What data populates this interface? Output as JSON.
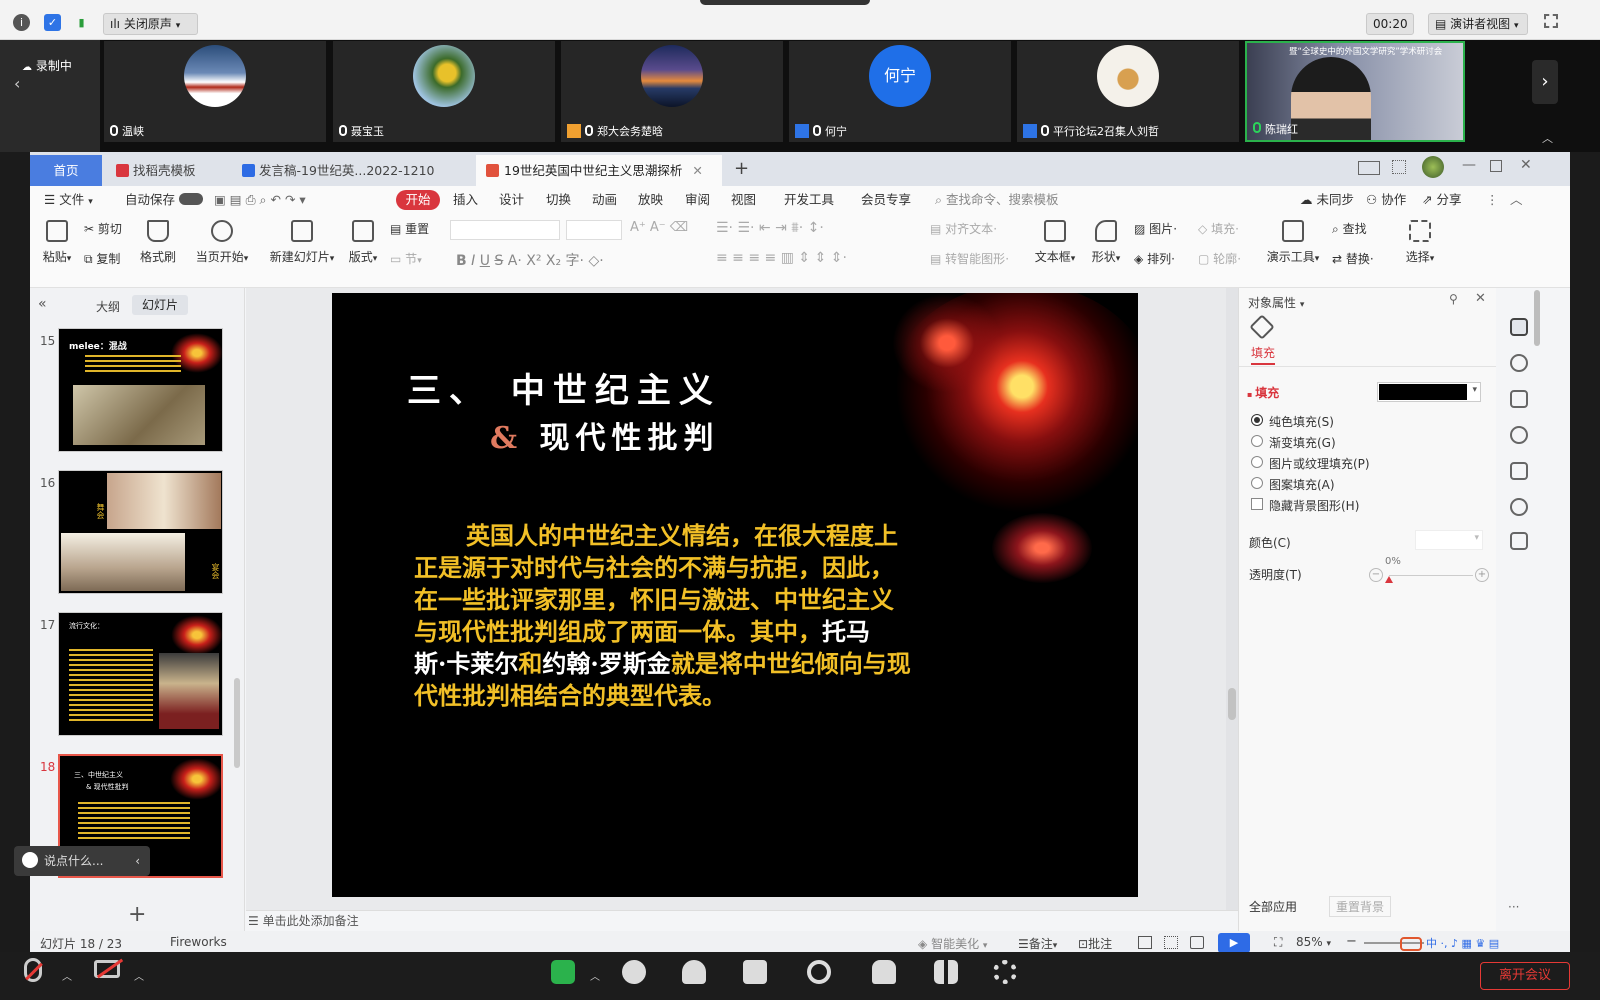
{
  "topbar": {
    "mute_label": "关闭原声",
    "timer": "00:20",
    "view_label": "演讲者视图"
  },
  "participants": {
    "recording": "录制中",
    "tiles": [
      {
        "name": "温峡"
      },
      {
        "name": "聂宝玉"
      },
      {
        "name": "郑大会务楚晗"
      },
      {
        "name": "何宁",
        "avatar_text": "何宁"
      },
      {
        "name": "平行论坛2召集人刘哲"
      },
      {
        "name": "陈瑞红",
        "shared_title": "暨“全球史中的外国文学研究”学术研讨会"
      }
    ]
  },
  "wps": {
    "tabs": {
      "home": "首页",
      "template": "找稻壳模板",
      "doc": "发言稿-19世纪英...2022-1210",
      "ppt": "19世纪英国中世纪主义思潮探析"
    },
    "menu": {
      "file": "文件",
      "autosave": "自动保存",
      "start": "开始",
      "insert": "插入",
      "design": "设计",
      "switch": "切换",
      "animation": "动画",
      "play": "放映",
      "review": "审阅",
      "view": "视图",
      "dev": "开发工具",
      "member": "会员专享",
      "search": "查找命令、搜索模板",
      "unsynced": "未同步",
      "collab": "协作",
      "share": "分享"
    },
    "ribbon": {
      "paste": "粘贴",
      "cut": "剪切",
      "copy": "复制",
      "format_painter": "格式刷",
      "play_from_current": "当页开始",
      "new_slide": "新建幻灯片",
      "layout": "版式",
      "reset": "重置",
      "section": "节",
      "align_text": "对齐文本",
      "smart_shape": "转智能图形",
      "textbox": "文本框",
      "shape": "形状",
      "picture": "图片",
      "arrange": "排列",
      "fill": "填充",
      "outline": "轮廓",
      "present_tool": "演示工具",
      "find": "查找",
      "replace": "替换",
      "select": "选择"
    },
    "left_panel": {
      "outline_tab": "大纲",
      "slides_tab": "幻灯片",
      "slide_numbers": [
        "15",
        "16",
        "17",
        "18"
      ],
      "thumb15_title": "melee：混战",
      "thumb16_left": "舞会",
      "thumb16_right": "宴会",
      "thumb17_title": "流行文化：",
      "thumb18_title": "三、中世纪主义",
      "thumb18_sub": "& 现代性批判",
      "chat_placeholder": "说点什么..."
    },
    "slide": {
      "title_line1": "三、 中世纪主义",
      "title_amp": "&",
      "title_line2": "现代性批判",
      "body_line1": "英国人的中世纪主义情结，在很大程度上",
      "body_line2": "正是源于对时代与社会的不满与抗拒，因此，",
      "body_line3": "在一些批评家那里，怀旧与激进、中世纪主义",
      "body_line4a": "与现代性批判组成了两面一体。其中，",
      "body_line4b": "托马",
      "body_line5a": "斯·卡莱尔",
      "body_line5b": "和",
      "body_line5c": "约翰·罗斯金",
      "body_line5d": "就是将中世纪倾向与现",
      "body_line6": "代性批判相结合的典型代表。"
    },
    "notes_placeholder": "单击此处添加备注",
    "properties": {
      "title": "对象属性",
      "fill_tab": "填充",
      "fill_section": "填充",
      "fill_color": "#000000",
      "options": [
        "纯色填充(S)",
        "渐变填充(G)",
        "图片或纹理填充(P)",
        "图案填充(A)"
      ],
      "hide_bg": "隐藏背景图形(H)",
      "color_label": "颜色(C)",
      "transparency_label": "透明度(T)",
      "transparency_value": "0%",
      "apply_all": "全部应用",
      "reset_bg": "重置背景"
    },
    "status": {
      "slide_counter": "幻灯片 18 / 23",
      "theme": "Fireworks",
      "smart_beautify": "智能美化",
      "notes": "备注",
      "comments": "批注",
      "zoom": "85%"
    }
  },
  "meeting_bar": {
    "leave": "离开会议"
  },
  "colors": {
    "slide_gold": "#f2c027",
    "slide_white": "#ffffff",
    "wps_red": "#d9363e",
    "zoom_blue": "#1a6fe0"
  }
}
